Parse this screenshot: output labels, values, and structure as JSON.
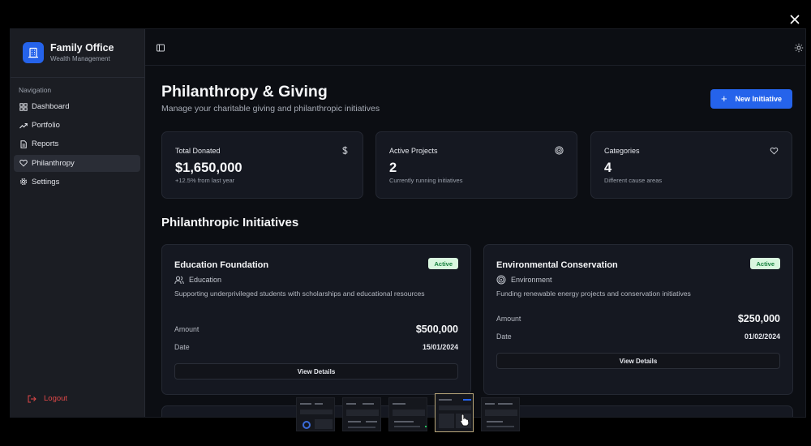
{
  "app": {
    "brand_title": "Family Office",
    "brand_subtitle": "Wealth Management",
    "accent_color": "#2563eb"
  },
  "sidebar": {
    "section_label": "Navigation",
    "items": [
      {
        "label": "Dashboard",
        "icon": "grid-icon",
        "active": false
      },
      {
        "label": "Portfolio",
        "icon": "trending-up-icon",
        "active": false
      },
      {
        "label": "Reports",
        "icon": "file-text-icon",
        "active": false
      },
      {
        "label": "Philanthropy",
        "icon": "heart-icon",
        "active": true
      },
      {
        "label": "Settings",
        "icon": "gear-icon",
        "active": false
      }
    ],
    "logout_label": "Logout"
  },
  "header": {
    "title": "Philanthropy & Giving",
    "subtitle": "Manage your charitable giving and philanthropic initiatives",
    "new_button_label": "New Initiative"
  },
  "stats": [
    {
      "label": "Total Donated",
      "value": "$1,650,000",
      "sub": "+12.5% from last year",
      "icon": "dollar-icon"
    },
    {
      "label": "Active Projects",
      "value": "2",
      "sub": "Currently running initiatives",
      "icon": "target-icon"
    },
    {
      "label": "Categories",
      "value": "4",
      "sub": "Different cause areas",
      "icon": "heart-icon"
    }
  ],
  "section_title": "Philanthropic Initiatives",
  "initiatives": [
    {
      "title": "Education Foundation",
      "status": "Active",
      "category": "Education",
      "category_icon": "users-icon",
      "description": "Supporting underprivileged students with scholarships and educational resources",
      "amount_label": "Amount",
      "amount": "$500,000",
      "date_label": "Date",
      "date": "15/01/2024",
      "button_label": "View Details"
    },
    {
      "title": "Environmental Conservation",
      "status": "Active",
      "category": "Environment",
      "category_icon": "target-icon",
      "description": "Funding renewable energy projects and conservation initiatives",
      "amount_label": "Amount",
      "amount": "$250,000",
      "date_label": "Date",
      "date": "01/02/2024",
      "button_label": "View Details"
    }
  ],
  "gallery": {
    "thumbnail_count": 5,
    "selected_index": 4
  },
  "colors": {
    "status_active_bg": "#d9f7df",
    "status_active_text": "#15803d",
    "logout": "#e04848"
  }
}
